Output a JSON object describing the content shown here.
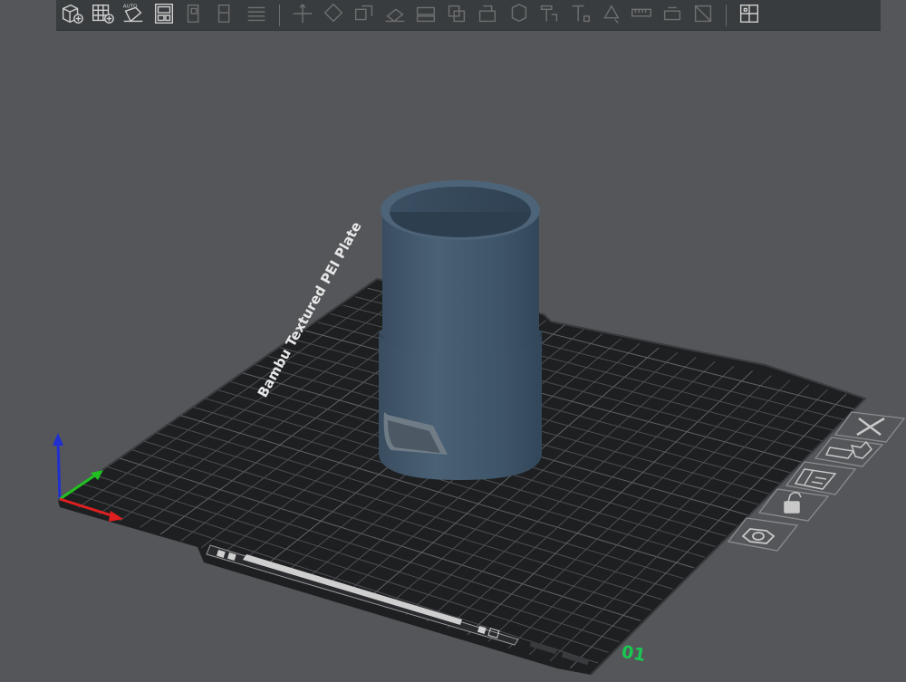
{
  "toolbar": {
    "buttons": [
      {
        "name": "add-object-button",
        "icon": "cube-plus-icon",
        "enabled": true
      },
      {
        "name": "add-plate-button",
        "icon": "grid-plus-icon",
        "enabled": true
      },
      {
        "name": "auto-orient-button",
        "icon": "auto-orient-icon",
        "enabled": true,
        "label": "AUTO"
      },
      {
        "name": "arrange-button",
        "icon": "arrange-icon",
        "enabled": true
      },
      {
        "name": "split-objects-button",
        "icon": "split-objects-icon",
        "enabled": false
      },
      {
        "name": "split-parts-button",
        "icon": "split-parts-icon",
        "enabled": false
      },
      {
        "name": "layers-button",
        "icon": "layers-icon",
        "enabled": false
      },
      {
        "name": "move-button",
        "icon": "move-icon",
        "enabled": false
      },
      {
        "name": "rotate-button",
        "icon": "rotate-icon",
        "enabled": false
      },
      {
        "name": "scale-button",
        "icon": "scale-icon",
        "enabled": false
      },
      {
        "name": "lay-on-face-button",
        "icon": "lay-on-face-icon",
        "enabled": false
      },
      {
        "name": "cut-button",
        "icon": "cut-icon",
        "enabled": false
      },
      {
        "name": "mesh-boolean-button",
        "icon": "boolean-icon",
        "enabled": false
      },
      {
        "name": "support-paint-button",
        "icon": "support-paint-icon",
        "enabled": false
      },
      {
        "name": "seam-paint-button",
        "icon": "seam-paint-icon",
        "enabled": false
      },
      {
        "name": "assemble-button",
        "icon": "assemble-icon",
        "enabled": false
      },
      {
        "name": "text-shape-button",
        "icon": "text-shape-icon",
        "enabled": false
      },
      {
        "name": "color-paint-button",
        "icon": "color-paint-icon",
        "enabled": false
      },
      {
        "name": "measure-button",
        "icon": "measure-icon",
        "enabled": false
      },
      {
        "name": "brim-ears-button",
        "icon": "brim-ears-icon",
        "enabled": false
      },
      {
        "name": "simplify-button",
        "icon": "simplify-icon",
        "enabled": false
      },
      {
        "name": "assembly-view-button",
        "icon": "assembly-view-icon",
        "enabled": true
      }
    ]
  },
  "plate": {
    "label": "Bambu Textured PEI Plate",
    "number": "01",
    "number_color": "#19c850"
  },
  "plate_tools": [
    {
      "name": "delete-plate-button",
      "icon": "close-icon"
    },
    {
      "name": "auto-orient-plate-button",
      "icon": "orient-plate-icon"
    },
    {
      "name": "arrange-plate-button",
      "icon": "arrange-plate-icon"
    },
    {
      "name": "lock-plate-button",
      "icon": "unlock-icon"
    },
    {
      "name": "plate-settings-button",
      "icon": "gear-hex-icon"
    }
  ],
  "model": {
    "color": "#3e5468"
  },
  "axes": {
    "x_color": "#e02020",
    "y_color": "#20c020",
    "z_color": "#2030d0"
  }
}
